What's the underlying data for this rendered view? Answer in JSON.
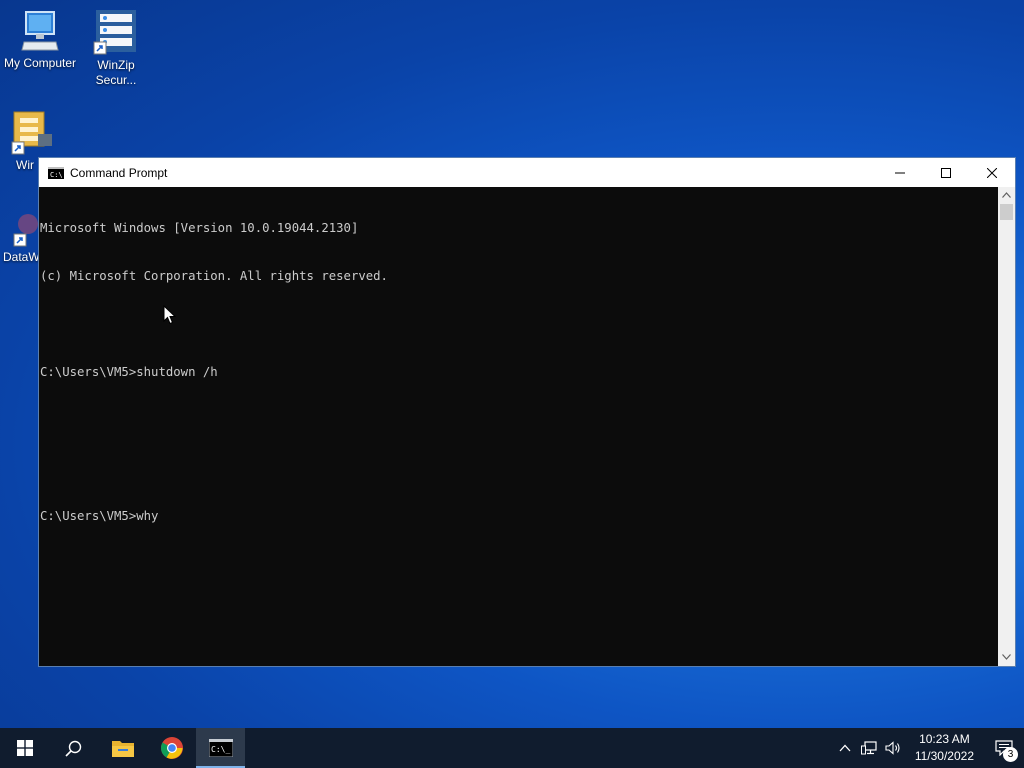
{
  "desktop": {
    "icons": [
      {
        "label": "My Computer"
      },
      {
        "label": "WinZip Secur..."
      },
      {
        "label": "Wir"
      },
      {
        "label": "DataW"
      }
    ]
  },
  "window": {
    "title": "Command Prompt",
    "icon": "cmd-icon",
    "controls": [
      "minimize-icon",
      "maximize-icon",
      "close-icon"
    ]
  },
  "console": {
    "lines": [
      "Microsoft Windows [Version 10.0.19044.2130]",
      "(c) Microsoft Corporation. All rights reserved.",
      "",
      "C:\\Users\\VM5>shutdown /h",
      "",
      "",
      "C:\\Users\\VM5>why"
    ]
  },
  "taskbar": {
    "items": [
      "start-icon",
      "search-icon",
      "file-explorer-icon",
      "chrome-icon",
      "cmd-icon"
    ],
    "clock_time": "10:23 AM",
    "clock_date": "11/30/2022",
    "notification_count": "3",
    "tray_icons": [
      "chevron-up-icon",
      "network-icon",
      "volume-icon"
    ]
  }
}
